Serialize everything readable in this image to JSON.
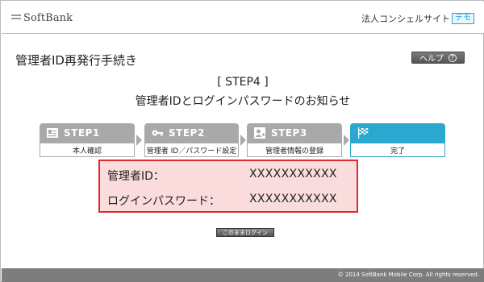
{
  "header": {
    "logo_text": "SoftBank",
    "site_title": "法人コンシェルサイト",
    "demo_label": "デモ"
  },
  "page": {
    "title": "管理者ID再発行手続き",
    "help_label": "ヘルプ",
    "help_icon": "?",
    "step_heading": "[ STEP4 ]",
    "step_subheading": "管理者IDとログインパスワードのお知らせ"
  },
  "steps": [
    {
      "tab": "STEP1",
      "label": "本人確認",
      "icon": "id-card-icon",
      "active": false
    },
    {
      "tab": "STEP2",
      "label": "管理者 ID／パスワード設定",
      "icon": "key-icon",
      "active": false
    },
    {
      "tab": "STEP3",
      "label": "管理者情報の登録",
      "icon": "user-add-icon",
      "active": false
    },
    {
      "tab": "",
      "label": "完了",
      "icon": "checkered-flag-icon",
      "active": true
    }
  ],
  "info": {
    "id_label": "管理者ID：",
    "id_value": "XXXXXXXXXXX",
    "password_label": "ログインパスワード：",
    "password_value": "XXXXXXXXXXX"
  },
  "actions": {
    "login_label": "このままログイン"
  },
  "footer": {
    "copyright": "© 2014 SoftBank Mobile Corp. All rights reserved."
  },
  "colors": {
    "step_inactive": "#a9a9a9",
    "step_active": "#2aa8cf",
    "alert_border": "#e0282d",
    "alert_fill": "#fbdcdc",
    "footer": "#7d7d7d"
  }
}
